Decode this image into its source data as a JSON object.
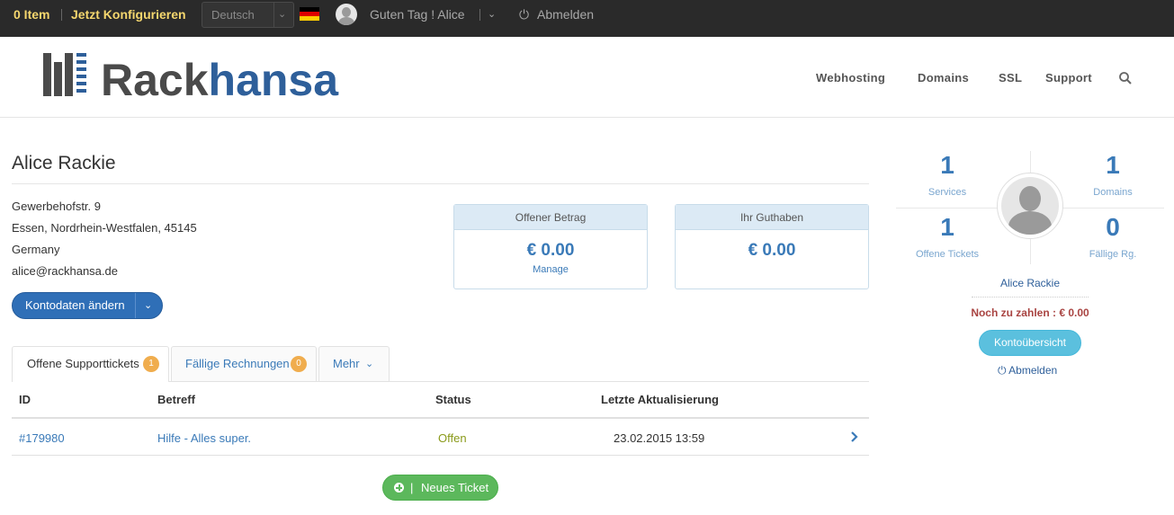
{
  "topbar": {
    "cart": "0 Item",
    "configure": "Jetzt Konfigurieren",
    "language": "Deutsch",
    "greeting": "Guten Tag ! Alice",
    "logout": "Abmelden",
    "flag_colors": [
      "#000000",
      "#dd0000",
      "#ffce00"
    ]
  },
  "brand": {
    "logo_part1": "Rack",
    "logo_part2": "hansa",
    "color_dark": "#4a4a4a",
    "color_blue": "#2e5f9a"
  },
  "nav": {
    "items": [
      "Webhosting",
      "Domains",
      "SSL",
      "Support"
    ],
    "search_icon": "search-icon"
  },
  "account": {
    "name": "Alice Rackie",
    "street": "Gewerbehofstr. 9",
    "city": "Essen, Nordrhein-Westfalen, 45145",
    "country": "Germany",
    "email": "alice@rackhansa.de",
    "edit_button": "Kontodaten ändern"
  },
  "stats": {
    "open_amount": {
      "title": "Offener Betrag",
      "value": "€ 0.00",
      "link": "Manage"
    },
    "credit": {
      "title": "Ihr Guthaben",
      "value": "€ 0.00"
    }
  },
  "tabs": [
    {
      "label": "Offene Supporttickets",
      "badge": "1"
    },
    {
      "label": "Fällige Rechnungen",
      "badge": "0"
    },
    {
      "label": "Mehr"
    }
  ],
  "table": {
    "headers": [
      "ID",
      "Betreff",
      "Status",
      "Letzte Aktualisierung"
    ],
    "rows": [
      {
        "id": "#179980",
        "subject": "Hilfe - Alles super.",
        "status": "Offen",
        "updated": "23.02.2015 13:59"
      }
    ],
    "status_color": "#8a9a1a"
  },
  "new_ticket": {
    "separator": "|",
    "label": "Neues Ticket"
  },
  "sidebar": {
    "services": {
      "count": "1",
      "label": "Services"
    },
    "domains": {
      "count": "1",
      "label": "Domains"
    },
    "tickets": {
      "count": "1",
      "label": "Offene Tickets"
    },
    "invoices": {
      "count": "0",
      "label": "Fällige Rg."
    },
    "name": "Alice Rackie",
    "due": "Noch zu zahlen : € 0.00",
    "overview_button": "Kontoübersicht",
    "logout": "Abmelden"
  }
}
